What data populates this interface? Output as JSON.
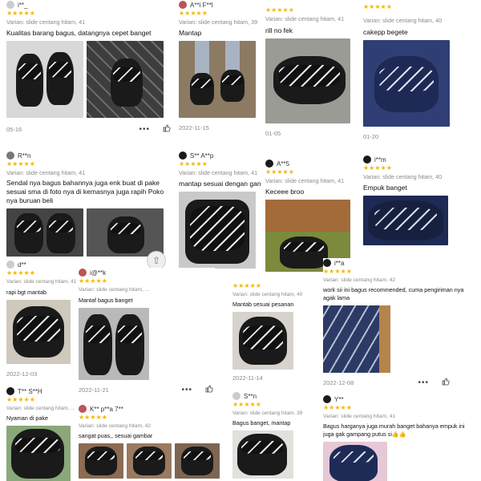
{
  "reviews": [
    {
      "user": "i**_",
      "variant": "Varian: slide centang hitam, 41",
      "text": "Kualitas barang bagus, datangnya cepet banget",
      "date": "05-16"
    },
    {
      "user": "A**i F**l",
      "variant": "Varian: slide centang hitam, 39",
      "text": "Mantap",
      "date": "2022-11-15"
    },
    {
      "user": "",
      "variant": "Varian: slide centang hitam, 41",
      "text": "rill no fek",
      "date": "01-05"
    },
    {
      "user": "",
      "variant": "Varian: slide centang hitam, 40",
      "text": "cakepp begete",
      "date": "01-20"
    },
    {
      "user": "R**n",
      "variant": "Varian: slide centang hitam, 41",
      "text": "Sendal nya bagus bahannya juga enk buat di pake sesuai sma di foto nya di kemasnya juga rapih Poko nya buruan beli",
      "date": ""
    },
    {
      "user": "S** A**p",
      "variant": "Varian: slide centang hitam, 41",
      "text": "mantap sesuai dengan gan",
      "date": ""
    },
    {
      "user": "A**5",
      "variant": "Varian: slide centang hitam, 41",
      "text": "Keceee broo",
      "date": ""
    },
    {
      "user": "i**m",
      "variant": "Varian: slide centang hitam, 40",
      "text": "Empuk banget",
      "date": ""
    },
    {
      "user": "d**",
      "variant": "Varian: slide centang hitam, 41",
      "text": "rapi bgt mantab",
      "date": "2022-12-03"
    },
    {
      "user": "i@**k",
      "variant": "Varian: slide centang hitam, ...",
      "text": "Mantaf bagus banget",
      "date": "2022-11-21"
    },
    {
      "user": "",
      "variant": "Varian: slide centang hitam, 40",
      "text": "Mantab sesuai pesanan",
      "date": "2022-11-14"
    },
    {
      "user": "i**a",
      "variant": "Varian: slide centang hitam, 42",
      "text": "work sii ini bagus recommended, cuma pengiriman nya agak lama",
      "date": "2022-12-08"
    },
    {
      "user": "T** S**H",
      "variant": "Varian: slide centang hitam, ...",
      "text": "Nyaman di pake",
      "date": ""
    },
    {
      "user": "K** p**a 7**",
      "variant": "Varian: slide centang hitam, 42",
      "text": "sangat puas,, sesuai gambar",
      "date": ""
    },
    {
      "user": "S**n",
      "variant": "Varian: slide centang hitam, 39",
      "text": "Bagus banget, mantap",
      "date": ""
    },
    {
      "user": "Y**",
      "variant": "Varian: slide centang hitam, 41",
      "text": "Bagus harganya juga murah banget bahanya empuk ini juga gak gampang putus si👍👍",
      "date": ""
    }
  ],
  "stars": "★★★★★",
  "dots": "•••",
  "scroll_icon": "⇧"
}
